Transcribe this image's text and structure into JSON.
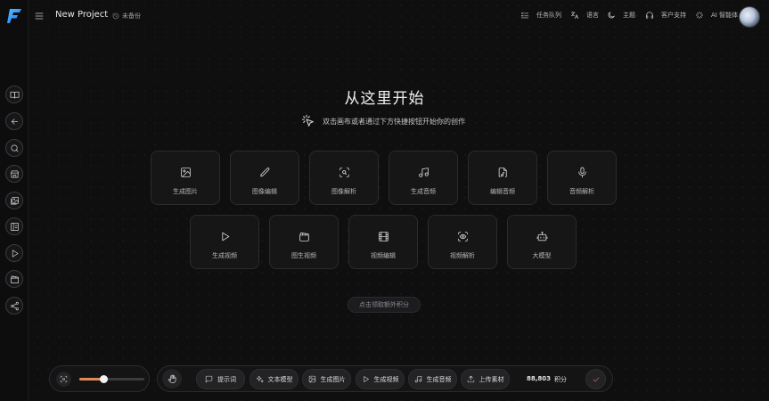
{
  "header": {
    "project_title": "New Project",
    "backup_status": "未备份",
    "task_queue": "任务队列",
    "language": "语言",
    "theme": "主题",
    "support": "客户支持",
    "agent": "AI 智能体"
  },
  "hero": {
    "title": "从这里开始",
    "subtitle": "双击画布或者通过下方快捷按钮开始你的创作"
  },
  "cards_row1": [
    {
      "label": "生成图片",
      "icon": "image-icon"
    },
    {
      "label": "图像编辑",
      "icon": "pencil-icon"
    },
    {
      "label": "图像解析",
      "icon": "scan-search-icon"
    },
    {
      "label": "生成音频",
      "icon": "music-note-icon"
    },
    {
      "label": "编辑音频",
      "icon": "audio-file-icon"
    },
    {
      "label": "音频解析",
      "icon": "microphone-icon"
    }
  ],
  "cards_row2": [
    {
      "label": "生成视频",
      "icon": "play-icon"
    },
    {
      "label": "图生视频",
      "icon": "clapperboard-icon"
    },
    {
      "label": "视频编辑",
      "icon": "film-icon"
    },
    {
      "label": "视频解析",
      "icon": "scan-eye-icon"
    },
    {
      "label": "大模型",
      "icon": "robot-icon"
    }
  ],
  "credits_button": "点击领取额外积分",
  "toolbar": {
    "zoom_level": 0.37,
    "prompt": "提示词",
    "text_model": "文本模型",
    "gen_image": "生成图片",
    "gen_video": "生成视频",
    "gen_audio": "生成音频",
    "upload": "上传素材",
    "points_value": "88,803",
    "points_unit": "积分"
  },
  "colors": {
    "accent": "#e08a5a",
    "confirm": "#e0665a",
    "logo": "#2f9bff"
  }
}
